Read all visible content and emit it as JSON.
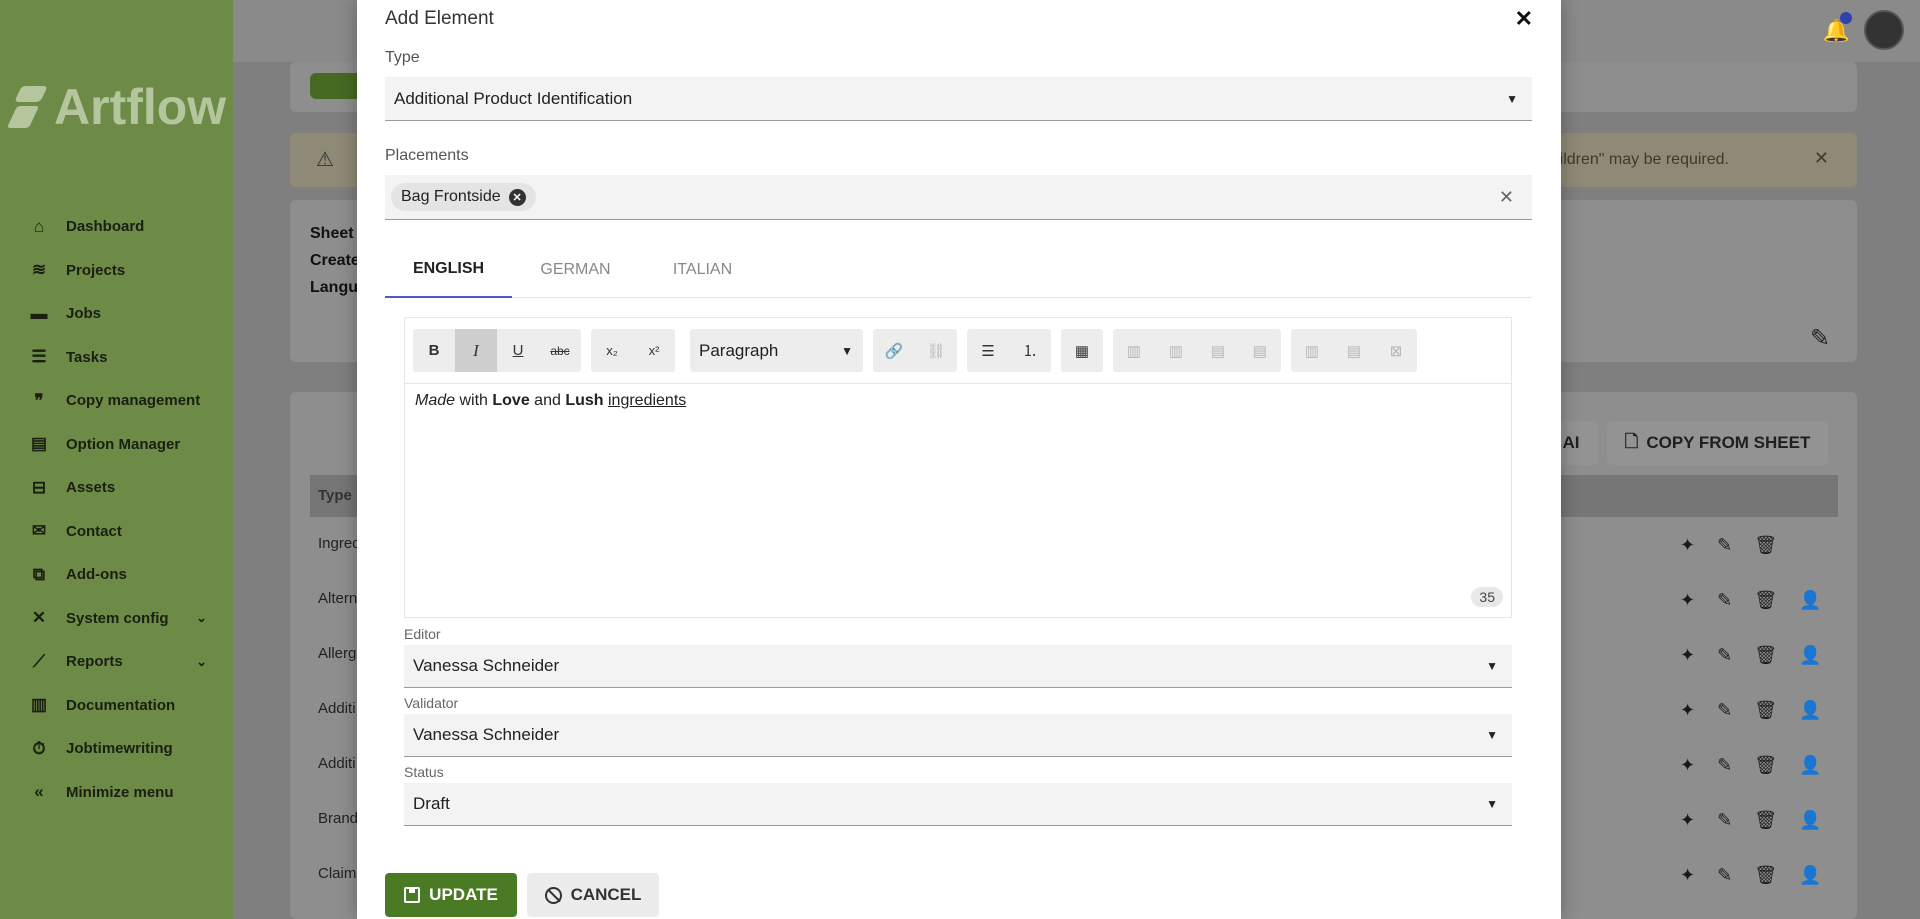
{
  "sidebar": {
    "logo": "Artflow",
    "items": [
      {
        "label": "Dashboard",
        "icon": "home-icon"
      },
      {
        "label": "Projects",
        "icon": "layers-icon"
      },
      {
        "label": "Jobs",
        "icon": "server-icon"
      },
      {
        "label": "Tasks",
        "icon": "checklist-icon"
      },
      {
        "label": "Copy management",
        "icon": "quote-icon"
      },
      {
        "label": "Option Manager",
        "icon": "list-box-icon"
      },
      {
        "label": "Assets",
        "icon": "tree-icon"
      },
      {
        "label": "Contact",
        "icon": "envelope-icon"
      },
      {
        "label": "Add-ons",
        "icon": "puzzle-icon"
      },
      {
        "label": "System config",
        "icon": "tools-icon",
        "expandable": true
      },
      {
        "label": "Reports",
        "icon": "chart-icon",
        "expandable": true
      },
      {
        "label": "Documentation",
        "icon": "books-icon"
      },
      {
        "label": "Jobtimewriting",
        "icon": "stopwatch-icon"
      },
      {
        "label": "Minimize menu",
        "icon": "double-chevron-left-icon"
      }
    ]
  },
  "background": {
    "alert_text": "in children\" may be required.",
    "sheet_labels": [
      "Sheet",
      "Create",
      "Langu"
    ],
    "table_header": "Type",
    "row_labels": [
      "Ingred",
      "Altern",
      "Allerg",
      "Additi",
      "Additi",
      "Brand",
      "Claim"
    ],
    "copy_from_sheet": "COPY FROM SHEET",
    "ai_label": "AI"
  },
  "modal": {
    "title": "Add Element",
    "type_label": "Type",
    "type_value": "Additional Product Identification",
    "placements_label": "Placements",
    "placement_chip": "Bag Frontside",
    "tabs": [
      "ENGLISH",
      "GERMAN",
      "ITALIAN"
    ],
    "active_tab": "ENGLISH",
    "editor": {
      "paragraph_select": "Paragraph",
      "content": {
        "w1": "Made",
        "w2": " with ",
        "w3": "Love",
        "w4": " and ",
        "w5": "Lush",
        "w6": " ",
        "w7": "ingredients"
      },
      "char_count": "35"
    },
    "editor_label": "Editor",
    "editor_value": "Vanessa Schneider",
    "validator_label": "Validator",
    "validator_value": "Vanessa Schneider",
    "status_label": "Status",
    "status_value": "Draft",
    "update_button": "UPDATE",
    "cancel_button": "CANCEL"
  }
}
